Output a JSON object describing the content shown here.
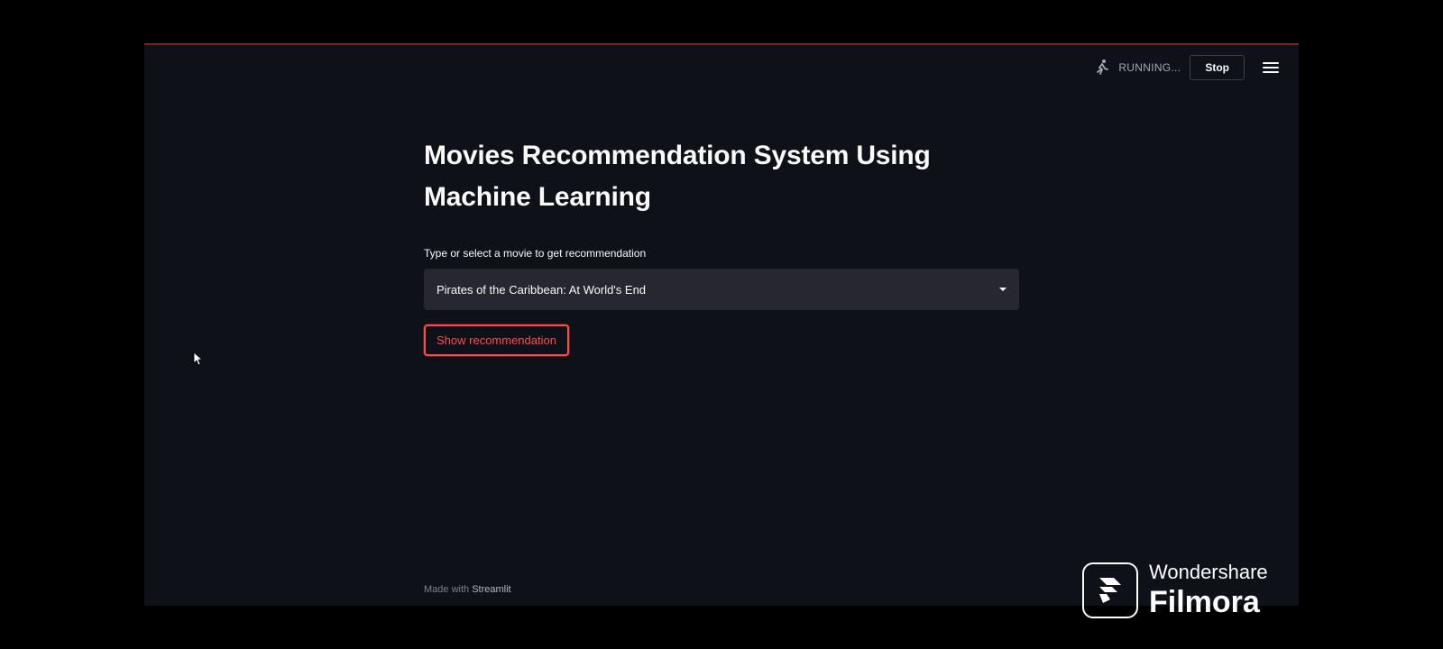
{
  "toolbar": {
    "status_text": "RUNNING...",
    "stop_label": "Stop",
    "running_icon": "running-person-icon",
    "menu_icon": "hamburger-menu-icon"
  },
  "main": {
    "title": "Movies Recommendation System Using Machine Learning",
    "select_label": "Type or select a movie to get recommendation",
    "selected_movie": "Pirates of the Caribbean: At World's End",
    "show_button_label": "Show recommendation"
  },
  "footer": {
    "made_with": "Made with",
    "brand": "Streamlit"
  },
  "watermark": {
    "company": "Wondershare",
    "product": "Filmora"
  },
  "colors": {
    "background": "#0e1117",
    "outer": "#000000",
    "accent": "#ff4b4b",
    "select_bg": "#262730",
    "text": "#fafafa"
  }
}
